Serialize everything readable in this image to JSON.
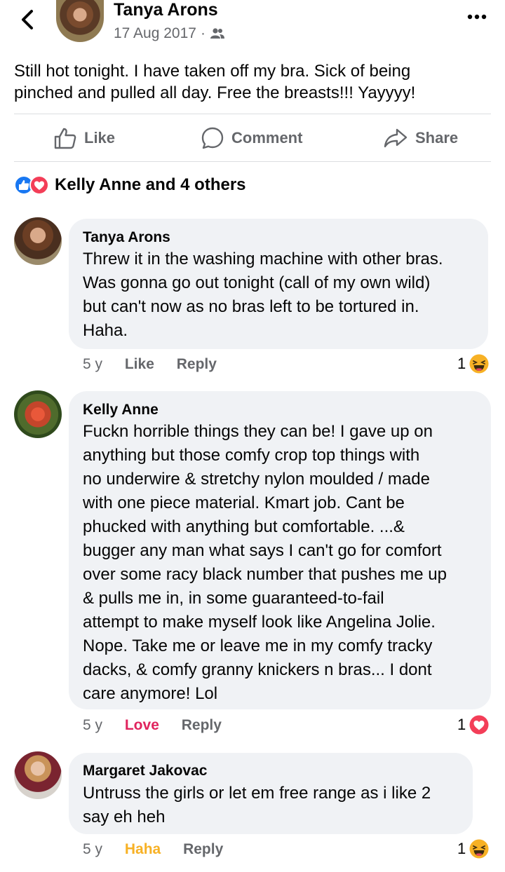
{
  "post": {
    "author": "Tanya Arons",
    "date": "17 Aug 2017",
    "separator": "·",
    "text": "Still hot tonight.  I have taken off my bra.  Sick of being\npinched and pulled all day.  Free the breasts!!!  Yayyyy!",
    "actions": {
      "like": "Like",
      "comment": "Comment",
      "share": "Share"
    },
    "reactions_label": "Kelly Anne and 4 others"
  },
  "comments": [
    {
      "name": "Tanya Arons",
      "text": "Threw it in the washing machine with other bras.\nWas gonna go out tonight (call of my own wild)\nbut can't now as no bras left to be tortured in.\nHaha.",
      "time": "5 y",
      "reaction_link": "Like",
      "reply": "Reply",
      "count": "1",
      "emoji": "haha"
    },
    {
      "name": "Kelly Anne",
      "text": "Fuckn horrible things they can be! I gave up on\nanything but those comfy crop top things with\nno underwire & stretchy nylon moulded / made\nwith one piece material. Kmart job. Cant be\nphucked with anything but comfortable. ...&\nbugger any man what says I can't go for comfort\nover some racy black number that pushes me up\n& pulls me in, in some guaranteed-to-fail\nattempt to make myself look like Angelina Jolie.\nNope. Take me or leave me in my comfy tracky\ndacks, & comfy granny knickers n bras... I dont\ncare anymore! Lol",
      "time": "5 y",
      "reaction_link": "Love",
      "reply": "Reply",
      "count": "1",
      "emoji": "love"
    },
    {
      "name": "Margaret Jakovac",
      "text": "Untruss the girls or let em free range as i like 2\nsay eh heh",
      "time": "5 y",
      "reaction_link": "Haha",
      "reply": "Reply",
      "count": "1",
      "emoji": "haha"
    }
  ],
  "colors": {
    "love": "#e0245e",
    "haha": "#f7b125",
    "like_blue": "#1877f2",
    "muted": "#65676b",
    "bubble": "#f0f2f5"
  },
  "icons": [
    "back-arrow-icon",
    "friends-audience-icon",
    "more-options-icon",
    "like-thumb-icon",
    "comment-bubble-icon",
    "share-arrow-icon",
    "like-reaction-icon",
    "love-reaction-icon",
    "haha-emoji-icon"
  ]
}
